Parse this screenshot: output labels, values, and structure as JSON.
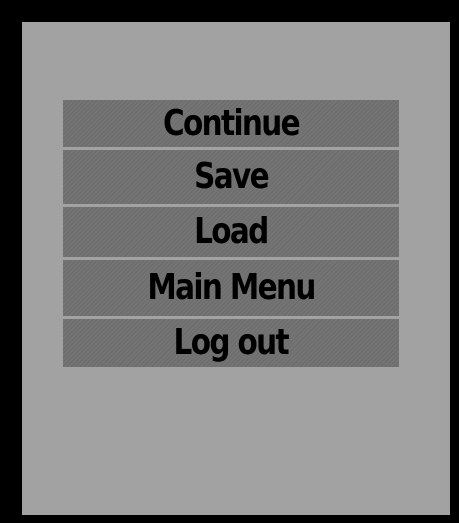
{
  "pause_menu": {
    "items": [
      {
        "label": "Continue"
      },
      {
        "label": "Save"
      },
      {
        "label": "Load"
      },
      {
        "label": "Main Menu"
      },
      {
        "label": "Log out"
      }
    ]
  },
  "colors": {
    "background": "#000000",
    "panel": "#a2a2a2",
    "button": "#747474",
    "text": "#000000"
  }
}
